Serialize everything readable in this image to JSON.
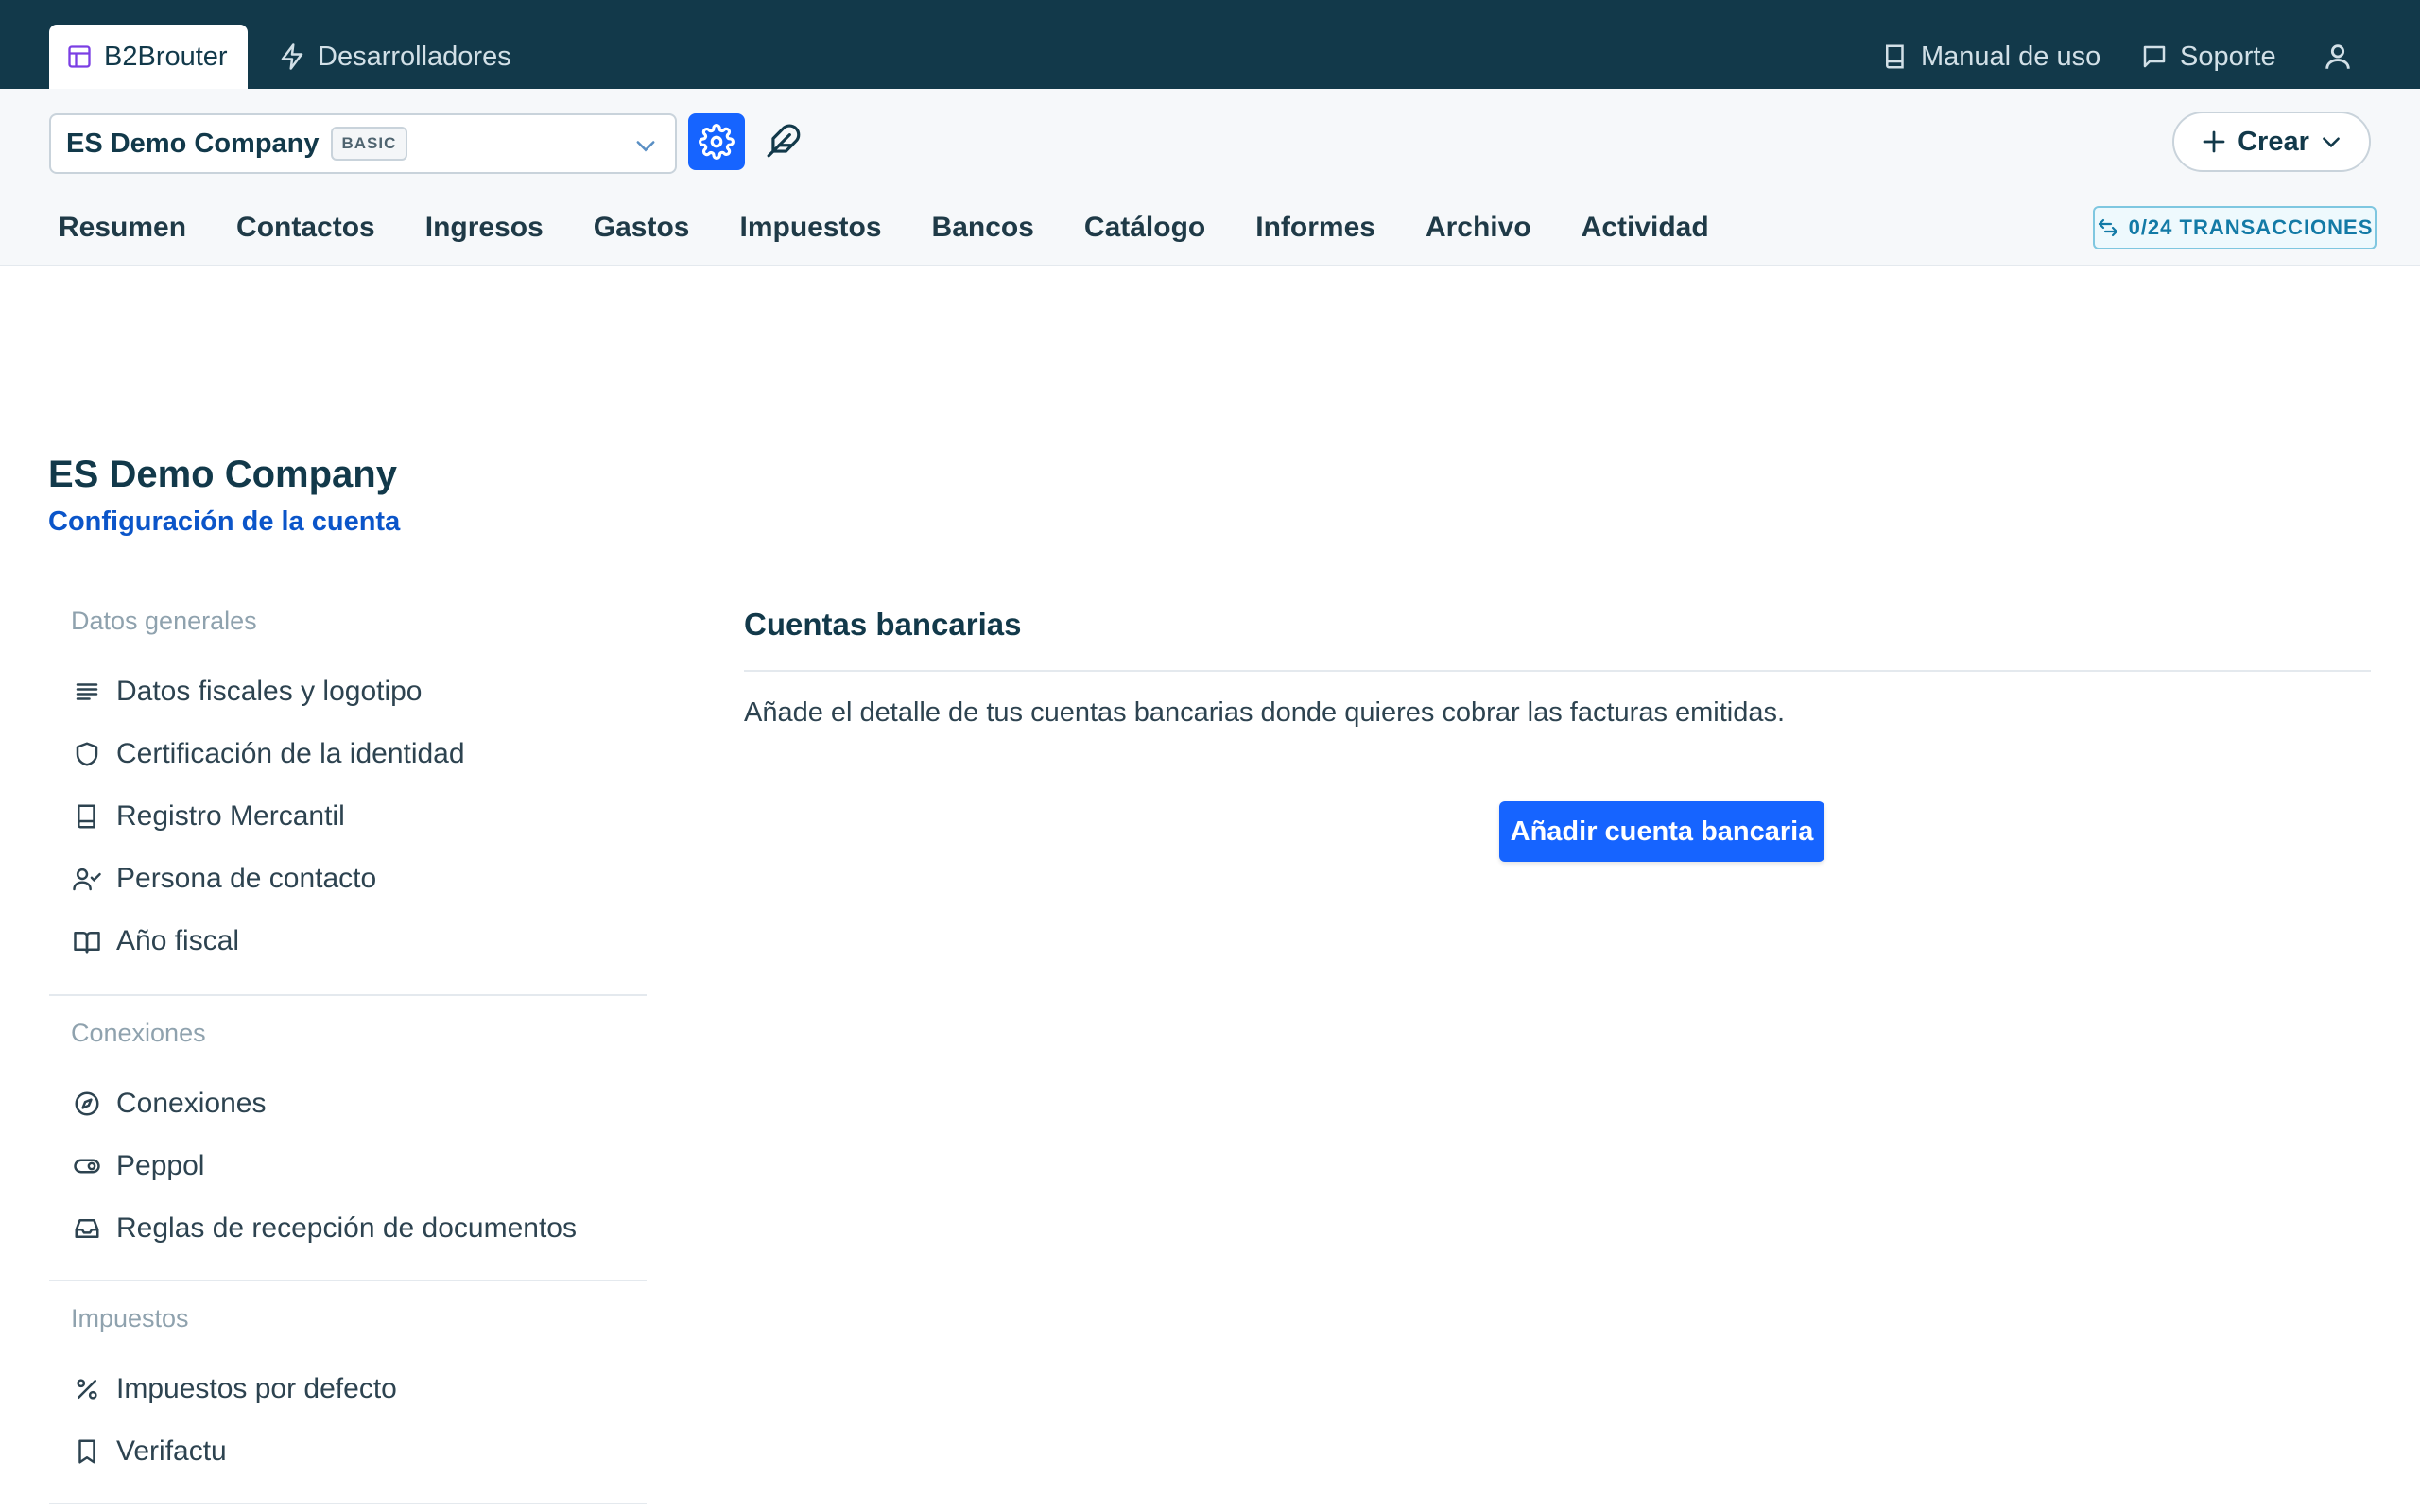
{
  "colors": {
    "topbar_bg": "#12394a",
    "primary_blue": "#1664ff",
    "link_blue": "#0b55c9",
    "badge_teal": "#137aa6"
  },
  "topbar": {
    "tabs": [
      {
        "label": "B2Brouter",
        "icon": "layout-icon",
        "active": true
      },
      {
        "label": "Desarrolladores",
        "icon": "lightning-icon",
        "active": false
      }
    ],
    "manual_label": "Manual de uso",
    "soporte_label": "Soporte",
    "user_icon": "user-icon"
  },
  "subheader": {
    "company_name": "ES Demo Company",
    "plan_badge": "BASIC",
    "crear_label": "Crear",
    "nav": [
      "Resumen",
      "Contactos",
      "Ingresos",
      "Gastos",
      "Impuestos",
      "Bancos",
      "Catálogo",
      "Informes",
      "Archivo",
      "Actividad"
    ],
    "transactions_badge": "0/24 TRANSACCIONES"
  },
  "page": {
    "title": "ES Demo Company",
    "subtitle": "Configuración de la cuenta"
  },
  "sidebar": {
    "sections": [
      {
        "title": "Datos generales",
        "items": [
          {
            "label": "Datos fiscales y logotipo",
            "icon": "lines-icon"
          },
          {
            "label": "Certificación de la identidad",
            "icon": "shield-icon"
          },
          {
            "label": "Registro Mercantil",
            "icon": "book-icon"
          },
          {
            "label": "Persona de contacto",
            "icon": "user-check-icon"
          },
          {
            "label": "Año fiscal",
            "icon": "open-book-icon"
          }
        ]
      },
      {
        "title": "Conexiones",
        "items": [
          {
            "label": "Conexiones",
            "icon": "compass-icon"
          },
          {
            "label": "Peppol",
            "icon": "toggle-icon"
          },
          {
            "label": "Reglas de recepción de documentos",
            "icon": "inbox-icon"
          }
        ]
      },
      {
        "title": "Impuestos",
        "items": [
          {
            "label": "Impuestos por defecto",
            "icon": "percent-icon"
          },
          {
            "label": "Verifactu",
            "icon": "bookmark-icon"
          }
        ]
      }
    ]
  },
  "main": {
    "title": "Cuentas bancarias",
    "description": "Añade el detalle de tus cuentas bancarias donde quieres cobrar las facturas emitidas.",
    "add_button": "Añadir cuenta bancaria"
  }
}
